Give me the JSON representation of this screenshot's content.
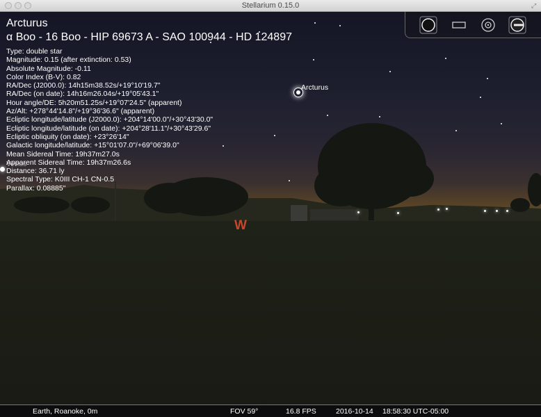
{
  "window": {
    "title": "Stellarium 0.15.0"
  },
  "object": {
    "name": "Arcturus",
    "designations": "α Boo - 16 Boo - HIP 69673 A - SAO 100944 - HD 124897",
    "details": [
      "Type: double star",
      "Magnitude: 0.15 (after extinction: 0.53)",
      "Absolute Magnitude: -0.11",
      "Color Index (B-V): 0.82",
      "RA/Dec (J2000.0): 14h15m38.52s/+19°10'19.7\"",
      "RA/Dec (on date): 14h16m26.04s/+19°05'43.1\"",
      "Hour angle/DE: 5h20m51.25s/+19°07'24.5\" (apparent)",
      "Az/Alt: +278°44'14.8\"/+19°36'36.6\" (apparent)",
      "Ecliptic longitude/latitude (J2000.0): +204°14'00.0\"/+30°43'30.0\"",
      "Ecliptic longitude/latitude (on date): +204°28'11.1\"/+30°43'29.6\"",
      "Ecliptic obliquity (on date): +23°26'14\"",
      "Galactic longitude/latitude: +15°01'07.0\"/+69°06'39.0\"",
      "Mean Sidereal Time: 19h37m27.0s",
      "Apparent Sidereal Time: 19h37m26.6s",
      "Distance: 36.71 ly",
      "Spectral Type: K0III CH-1 CN-0.5",
      "Parallax: 0.08885\""
    ]
  },
  "sky_labels": {
    "arcturus": "Arcturus",
    "venus": "Venus"
  },
  "cardinal": {
    "west": "W",
    "color": "#c8462a"
  },
  "status": {
    "location": "Earth, Roanoke, 0m",
    "fov": "FOV 59°",
    "fps": "16.8 FPS",
    "date": "2016-10-14",
    "time": "18:58:30 UTC-05:00"
  },
  "toolbar": {
    "icons": [
      "night-mode-icon",
      "fullscreen-icon",
      "ocular-icon",
      "exit-icon"
    ]
  }
}
